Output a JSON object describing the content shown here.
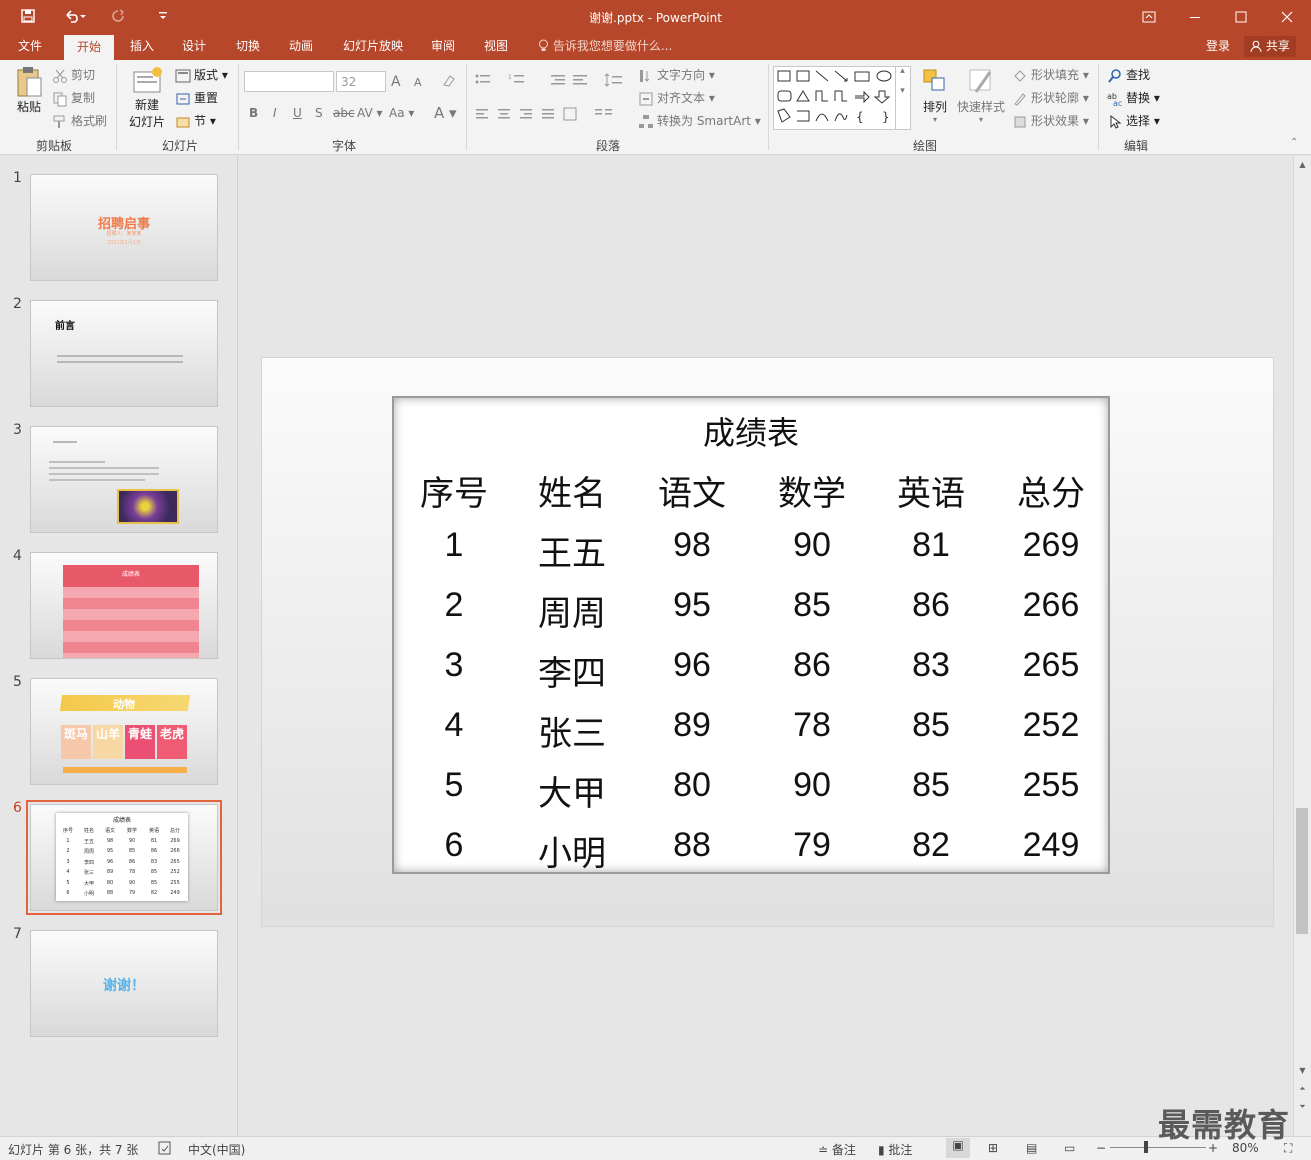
{
  "titlebar": {
    "doc_title": "谢谢.pptx - PowerPoint",
    "save_icon": "save-icon",
    "undo_icon": "undo-icon",
    "redo_icon": "redo-icon",
    "customize_icon": "customize-quick-access-icon",
    "window_buttons": [
      "ribbon-display-icon",
      "minimize-icon",
      "maximize-icon",
      "close-icon"
    ]
  },
  "tabs": [
    {
      "label": "文件"
    },
    {
      "label": "开始"
    },
    {
      "label": "插入"
    },
    {
      "label": "设计"
    },
    {
      "label": "切换"
    },
    {
      "label": "动画"
    },
    {
      "label": "幻灯片放映"
    },
    {
      "label": "审阅"
    },
    {
      "label": "视图"
    }
  ],
  "active_tab": "开始",
  "tell_me": "告诉我您想要做什么...",
  "login": "登录",
  "share": "共享",
  "ribbon": {
    "clipboard": {
      "paste": "粘贴",
      "cut": "剪切",
      "copy": "复制",
      "format_painter": "格式刷",
      "label": "剪贴板"
    },
    "slides": {
      "new_slide": "新建",
      "new_slide2": "幻灯片",
      "layout": "版式",
      "reset": "重置",
      "section": "节",
      "label": "幻灯片"
    },
    "font": {
      "font_name": "",
      "font_size": "32",
      "label": "字体",
      "bold": "B",
      "italic": "I",
      "underline": "U",
      "shadow": "S",
      "strike": "abc",
      "spacing": "AV",
      "case": "Aa",
      "color": "A",
      "grow": "A",
      "shrink": "A"
    },
    "paragraph": {
      "text_direction": "文字方向",
      "align_text": "对齐文本",
      "smartart": "转换为 SmartArt",
      "label": "段落"
    },
    "drawing": {
      "arrange": "排列",
      "quick_styles": "快速样式",
      "shape_fill": "形状填充",
      "shape_outline": "形状轮廓",
      "shape_effects": "形状效果",
      "label": "绘图"
    },
    "editing": {
      "find": "查找",
      "replace": "替换",
      "select": "选择",
      "label": "编辑"
    }
  },
  "thumbnails": [
    {
      "num": "1",
      "title": "招聘启事",
      "sub1": "招聘人：某某某",
      "sub2": "2021年1月1日"
    },
    {
      "num": "2",
      "title": "前言"
    },
    {
      "num": "3"
    },
    {
      "num": "4",
      "title": "成绩表"
    },
    {
      "num": "5",
      "title": "动物",
      "cards": [
        "斑马",
        "山羊",
        "青蛙",
        "老虎"
      ]
    },
    {
      "num": "6",
      "title": "成绩表"
    },
    {
      "num": "7",
      "title": "谢谢！"
    }
  ],
  "selected_slide": 6,
  "table": {
    "title": "成绩表",
    "headers": [
      "序号",
      "姓名",
      "语文",
      "数学",
      "英语",
      "总分"
    ],
    "rows": [
      [
        "1",
        "王五",
        "98",
        "90",
        "81",
        "269"
      ],
      [
        "2",
        "周周",
        "95",
        "85",
        "86",
        "266"
      ],
      [
        "3",
        "李四",
        "96",
        "86",
        "83",
        "265"
      ],
      [
        "4",
        "张三",
        "89",
        "78",
        "85",
        "252"
      ],
      [
        "5",
        "大甲",
        "80",
        "90",
        "85",
        "255"
      ],
      [
        "6",
        "小明",
        "88",
        "79",
        "82",
        "249"
      ]
    ]
  },
  "status": {
    "slide_info": "幻灯片 第 6 张，共 7 张",
    "language": "中文(中国)",
    "notes": "备注",
    "comments": "批注",
    "zoom": "80%"
  },
  "watermark": "最需教育",
  "colors": {
    "accent": "#b7472a",
    "selected_outline": "#e2643c"
  }
}
